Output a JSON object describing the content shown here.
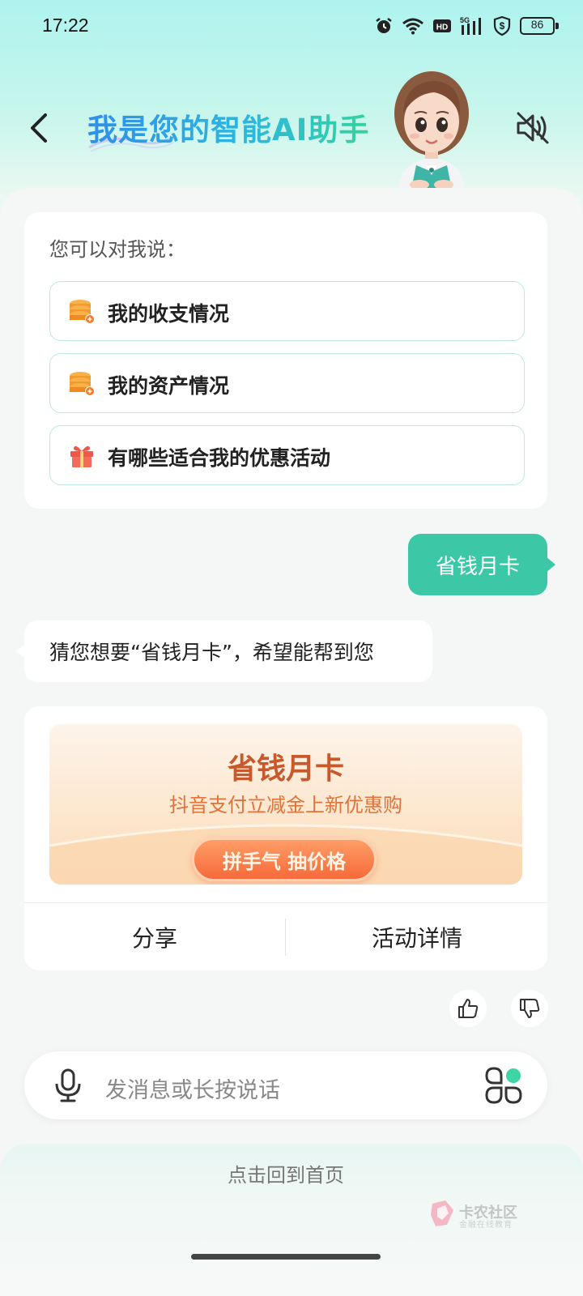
{
  "status_bar": {
    "time": "17:22",
    "battery": "86",
    "icons": [
      "alarm-icon",
      "wifi-icon",
      "hd-icon",
      "signal-5g-icon",
      "shield-icon",
      "battery-icon"
    ]
  },
  "header": {
    "title": "我是您的智能AI助手",
    "back_icon": "chevron-left-icon",
    "mute_icon": "speaker-muted-icon",
    "title_gradient": [
      "#2f8fe8",
      "#34d39c"
    ]
  },
  "suggestions": {
    "title": "您可以对我说：",
    "items": [
      {
        "label": "我的收支情况",
        "icon": "coin-stack-icon"
      },
      {
        "label": "我的资产情况",
        "icon": "coin-stack-icon"
      },
      {
        "label": "有哪些适合我的优惠活动",
        "icon": "gift-icon"
      }
    ]
  },
  "chat": {
    "user_message": "省钱月卡",
    "bot_message": "猜您想要“省钱月卡”，希望能帮到您"
  },
  "promo": {
    "title": "省钱月卡",
    "subtitle": "抖音支付立减金上新优惠购",
    "button": "拼手气 抽价格",
    "share": "分享",
    "details": "活动详情"
  },
  "feedback": {
    "like_icon": "thumbs-up-icon",
    "dislike_icon": "thumbs-down-icon"
  },
  "input": {
    "placeholder": "发消息或长按说话",
    "mic_icon": "microphone-icon",
    "apps_icon": "apps-grid-icon"
  },
  "footer": {
    "home_link": "点击回到首页",
    "watermark_title": "卡农社区",
    "watermark_sub": "金融在线教育"
  },
  "colors": {
    "accent": "#3cc8a6",
    "promo_orange": "#c9592a",
    "promo_button": "#f66a3a"
  }
}
